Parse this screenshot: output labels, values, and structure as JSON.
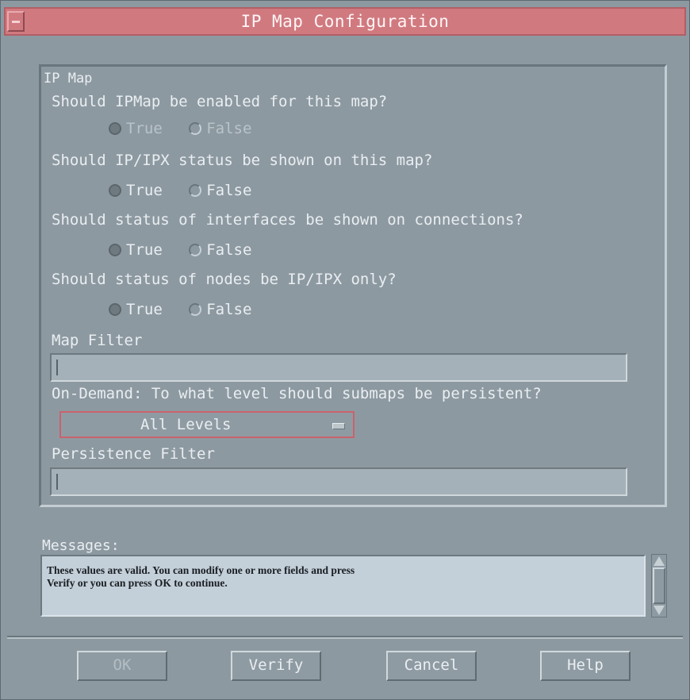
{
  "window": {
    "title": "IP Map Configuration"
  },
  "group": {
    "label": "IP Map"
  },
  "questions": [
    {
      "text": "Should IPMap be enabled for this map?",
      "true_label": "True",
      "false_label": "False",
      "selected": "True",
      "enabled": false
    },
    {
      "text": "Should IP/IPX status be shown on this map?",
      "true_label": "True",
      "false_label": "False",
      "selected": "True",
      "enabled": true
    },
    {
      "text": "Should status of interfaces be shown on connections?",
      "true_label": "True",
      "false_label": "False",
      "selected": "True",
      "enabled": true
    },
    {
      "text": "Should status of nodes be IP/IPX only?",
      "true_label": "True",
      "false_label": "False",
      "selected": "True",
      "enabled": true
    }
  ],
  "map_filter": {
    "label": "Map Filter",
    "value": ""
  },
  "on_demand": {
    "label": "On-Demand: To what level should submaps be persistent?",
    "selected": "All Levels"
  },
  "persistence_filter": {
    "label": "Persistence Filter",
    "value": ""
  },
  "messages": {
    "label": "Messages:",
    "line1": "These values are valid.  You can modify one or more fields and press",
    "line2": "Verify or you can press OK to continue."
  },
  "buttons": {
    "ok": "OK",
    "verify": "Verify",
    "cancel": "Cancel",
    "help": "Help"
  },
  "colors": {
    "title_bar": "#d07a80",
    "background": "#8d99a1",
    "message_box": "#c3cfd9"
  }
}
